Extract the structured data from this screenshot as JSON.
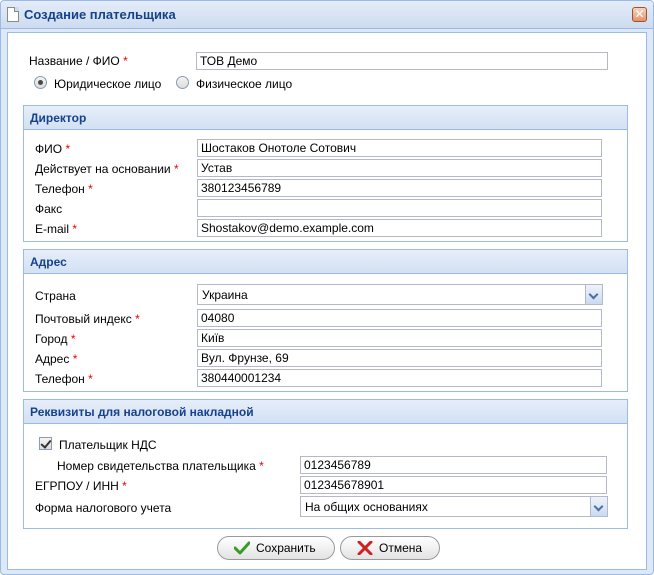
{
  "window": {
    "title": "Создание плательщика",
    "close": "✕"
  },
  "top": {
    "name_label": "Название / ФИО",
    "name_value": "ТОВ Демо",
    "radio_legal": "Юридическое лицо",
    "radio_physical": "Физическое лицо",
    "selected": "legal"
  },
  "director": {
    "header": "Директор",
    "fields": [
      {
        "label": "ФИО",
        "required": true,
        "value": "Шостаков Онотоле Сотович"
      },
      {
        "label": "Действует на основании",
        "required": true,
        "value": "Устав"
      },
      {
        "label": "Телефон",
        "required": true,
        "value": "380123456789"
      },
      {
        "label": "Факс",
        "required": false,
        "value": ""
      },
      {
        "label": "E-mail",
        "required": true,
        "value": "Shostakov@demo.example.com"
      }
    ]
  },
  "address": {
    "header": "Адрес",
    "country_label": "Страна",
    "country_value": "Украина",
    "fields": [
      {
        "label": "Почтовый индекс",
        "required": true,
        "value": "04080"
      },
      {
        "label": "Город",
        "required": true,
        "value": "Київ"
      },
      {
        "label": "Адрес",
        "required": true,
        "value": "Вул. Фрунзе, 69"
      },
      {
        "label": "Телефон",
        "required": true,
        "value": "380440001234"
      }
    ]
  },
  "tax": {
    "header": "Реквизиты для налоговой накладной",
    "vat_payer_label": "Плательщик НДС",
    "vat_payer_checked": true,
    "cert_label": "Номер свидетельства плательщика",
    "cert_value": "0123456789",
    "edrpou_label": "ЕГРПОУ / ИНН",
    "edrpou_value": "012345678901",
    "form_label": "Форма налогового учета",
    "form_value": "На общих основаниях"
  },
  "buttons": {
    "save": "Сохранить",
    "cancel": "Отмена"
  },
  "required_mark": "*",
  "colors": {
    "header_text": "#15428b",
    "border": "#99bbe8",
    "required": "#ee0000"
  }
}
